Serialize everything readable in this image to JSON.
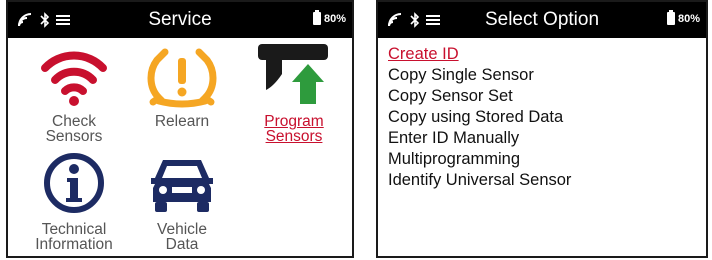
{
  "service_screen": {
    "title": "Service",
    "battery": "80%",
    "tiles": [
      {
        "label": "Check\nSensors",
        "icon": "wifi-icon"
      },
      {
        "label": "Relearn",
        "icon": "tire-pressure-warning-icon"
      },
      {
        "label": "Program\nSensors",
        "icon": "program-sensor-icon",
        "active": true
      },
      {
        "label": "Technical\nInformation",
        "icon": "info-icon"
      },
      {
        "label": "Vehicle\nData",
        "icon": "car-icon"
      }
    ]
  },
  "options_screen": {
    "title": "Select Option",
    "battery": "80%",
    "options": [
      "Create ID",
      "Copy Single Sensor",
      "Copy Sensor Set",
      "Copy using Stored Data",
      "Enter ID Manually",
      "Multiprogramming",
      "Identify Universal Sensor"
    ],
    "selected_index": 0
  },
  "status_icons": [
    "signal-icon",
    "bluetooth-icon",
    "menu-icon"
  ],
  "colors": {
    "statusbar": "#000000",
    "accent_red": "#c8102e",
    "relearn_amber": "#f5a623",
    "navy": "#1d2b63",
    "green_arrow": "#2e9b3d",
    "label_gray": "#555555"
  }
}
